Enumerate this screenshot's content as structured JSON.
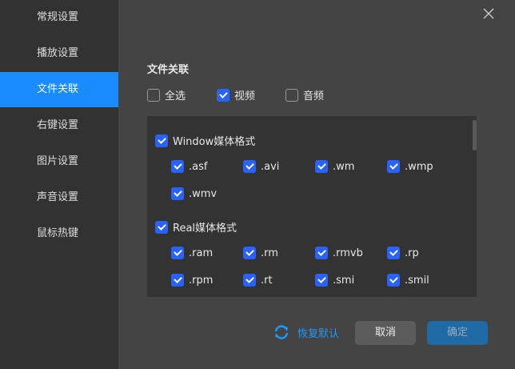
{
  "sidebar": {
    "items": [
      {
        "label": "常规设置"
      },
      {
        "label": "播放设置"
      },
      {
        "label": "文件关联"
      },
      {
        "label": "右键设置"
      },
      {
        "label": "图片设置"
      },
      {
        "label": "声音设置"
      },
      {
        "label": "鼠标热键"
      }
    ],
    "active_index": 2
  },
  "main": {
    "title": "文件关联",
    "filters": [
      {
        "label": "全选",
        "checked": false
      },
      {
        "label": "视频",
        "checked": true
      },
      {
        "label": "音频",
        "checked": false
      }
    ],
    "groups": [
      {
        "label": "Window媒体格式",
        "checked": true,
        "items": [
          ".asf",
          ".avi",
          ".wm",
          ".wmp",
          ".wmv"
        ]
      },
      {
        "label": "Real媒体格式",
        "checked": true,
        "items": [
          ".ram",
          ".rm",
          ".rmvb",
          ".rp",
          ".rpm",
          ".rt",
          ".smi",
          ".smil"
        ]
      }
    ]
  },
  "footer": {
    "restore_label": "恢复默认",
    "cancel_label": "取消",
    "ok_label": "确定"
  },
  "colors": {
    "accent": "#1a8cff",
    "checkbox": "#2962ff",
    "ok_button": "#1f6aa5"
  }
}
